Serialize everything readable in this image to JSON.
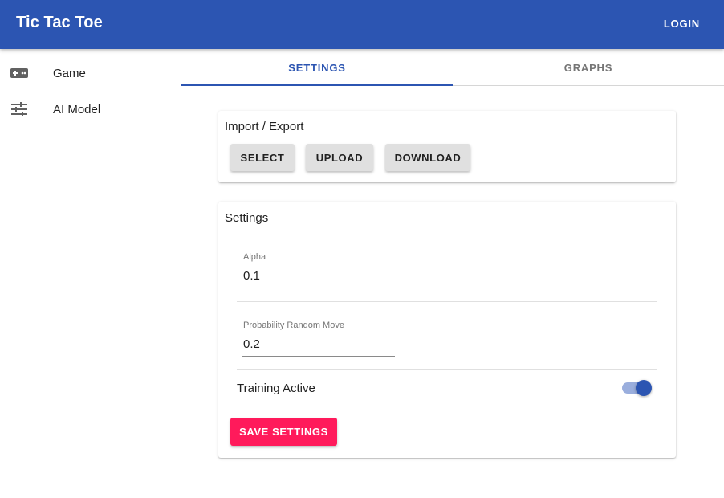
{
  "appbar": {
    "title": "Tic Tac Toe",
    "login_label": "LOGIN"
  },
  "sidebar": {
    "items": [
      {
        "label": "Game",
        "icon": "gamepad-icon"
      },
      {
        "label": "AI Model",
        "icon": "tune-icon"
      }
    ]
  },
  "tabs": [
    {
      "label": "SETTINGS",
      "active": true
    },
    {
      "label": "GRAPHS",
      "active": false
    }
  ],
  "import_export": {
    "title": "Import / Export",
    "buttons": [
      "SELECT",
      "UPLOAD",
      "DOWNLOAD"
    ]
  },
  "settings": {
    "title": "Settings",
    "fields": [
      {
        "label": "Alpha",
        "value": "0.1"
      },
      {
        "label": "Probability Random Move",
        "value": "0.2"
      }
    ],
    "training_label": "Training Active",
    "training_active": true,
    "save_label": "SAVE SETTINGS"
  },
  "colors": {
    "primary": "#2c55b2",
    "accent": "#ff1a5b",
    "button_grey": "#e0e0e0"
  }
}
